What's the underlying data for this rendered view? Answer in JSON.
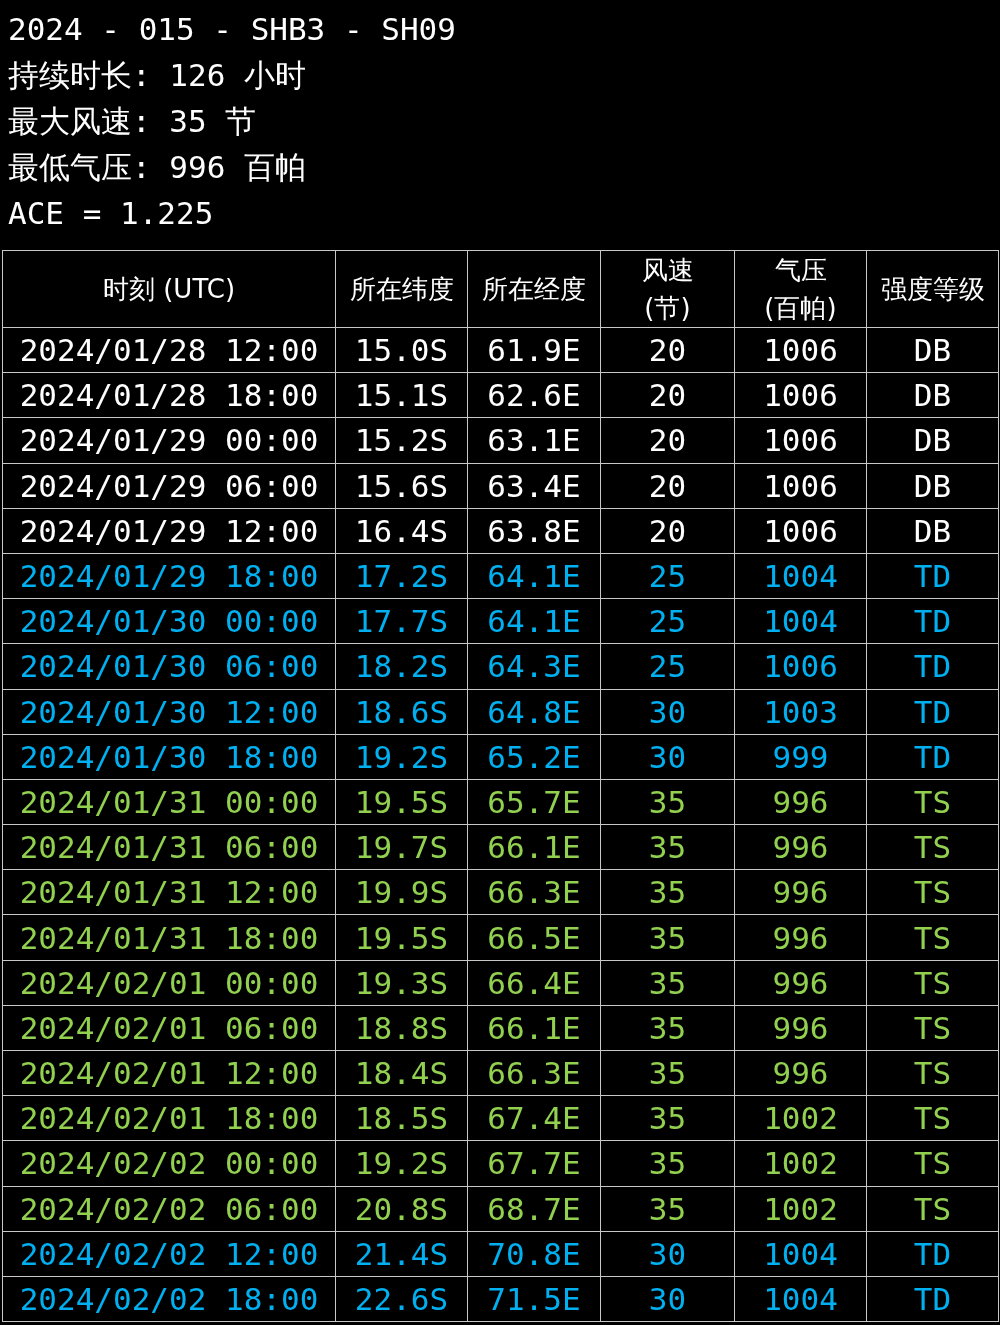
{
  "summary": {
    "title": "2024 - 015 - SHB3 - SH09",
    "lines": [
      "持续时长: 126 小时",
      "最大风速: 35 节",
      "最低气压: 996 百帕",
      "ACE = 1.225"
    ]
  },
  "table": {
    "columns": [
      "时刻 (UTC)",
      "所在纬度",
      "所在经度",
      "风速\n(节)",
      "气压\n(百帕)",
      "强度等级"
    ],
    "rows": [
      {
        "color": "#ffffff",
        "cells": [
          "2024/01/28 12:00",
          "15.0S",
          "61.9E",
          "20",
          "1006",
          "DB"
        ]
      },
      {
        "color": "#ffffff",
        "cells": [
          "2024/01/28 18:00",
          "15.1S",
          "62.6E",
          "20",
          "1006",
          "DB"
        ]
      },
      {
        "color": "#ffffff",
        "cells": [
          "2024/01/29 00:00",
          "15.2S",
          "63.1E",
          "20",
          "1006",
          "DB"
        ]
      },
      {
        "color": "#ffffff",
        "cells": [
          "2024/01/29 06:00",
          "15.6S",
          "63.4E",
          "20",
          "1006",
          "DB"
        ]
      },
      {
        "color": "#ffffff",
        "cells": [
          "2024/01/29 12:00",
          "16.4S",
          "63.8E",
          "20",
          "1006",
          "DB"
        ]
      },
      {
        "color": "#00b0f0",
        "cells": [
          "2024/01/29 18:00",
          "17.2S",
          "64.1E",
          "25",
          "1004",
          "TD"
        ]
      },
      {
        "color": "#00b0f0",
        "cells": [
          "2024/01/30 00:00",
          "17.7S",
          "64.1E",
          "25",
          "1004",
          "TD"
        ]
      },
      {
        "color": "#00b0f0",
        "cells": [
          "2024/01/30 06:00",
          "18.2S",
          "64.3E",
          "25",
          "1006",
          "TD"
        ]
      },
      {
        "color": "#00b0f0",
        "cells": [
          "2024/01/30 12:00",
          "18.6S",
          "64.8E",
          "30",
          "1003",
          "TD"
        ]
      },
      {
        "color": "#00b0f0",
        "cells": [
          "2024/01/30 18:00",
          "19.2S",
          "65.2E",
          "30",
          "999",
          "TD"
        ]
      },
      {
        "color": "#92d050",
        "cells": [
          "2024/01/31 00:00",
          "19.5S",
          "65.7E",
          "35",
          "996",
          "TS"
        ]
      },
      {
        "color": "#92d050",
        "cells": [
          "2024/01/31 06:00",
          "19.7S",
          "66.1E",
          "35",
          "996",
          "TS"
        ]
      },
      {
        "color": "#92d050",
        "cells": [
          "2024/01/31 12:00",
          "19.9S",
          "66.3E",
          "35",
          "996",
          "TS"
        ]
      },
      {
        "color": "#92d050",
        "cells": [
          "2024/01/31 18:00",
          "19.5S",
          "66.5E",
          "35",
          "996",
          "TS"
        ]
      },
      {
        "color": "#92d050",
        "cells": [
          "2024/02/01 00:00",
          "19.3S",
          "66.4E",
          "35",
          "996",
          "TS"
        ]
      },
      {
        "color": "#92d050",
        "cells": [
          "2024/02/01 06:00",
          "18.8S",
          "66.1E",
          "35",
          "996",
          "TS"
        ]
      },
      {
        "color": "#92d050",
        "cells": [
          "2024/02/01 12:00",
          "18.4S",
          "66.3E",
          "35",
          "996",
          "TS"
        ]
      },
      {
        "color": "#92d050",
        "cells": [
          "2024/02/01 18:00",
          "18.5S",
          "67.4E",
          "35",
          "1002",
          "TS"
        ]
      },
      {
        "color": "#92d050",
        "cells": [
          "2024/02/02 00:00",
          "19.2S",
          "67.7E",
          "35",
          "1002",
          "TS"
        ]
      },
      {
        "color": "#92d050",
        "cells": [
          "2024/02/02 06:00",
          "20.8S",
          "68.7E",
          "35",
          "1002",
          "TS"
        ]
      },
      {
        "color": "#00b0f0",
        "cells": [
          "2024/02/02 12:00",
          "21.4S",
          "70.8E",
          "30",
          "1004",
          "TD"
        ]
      },
      {
        "color": "#00b0f0",
        "cells": [
          "2024/02/02 18:00",
          "22.6S",
          "71.5E",
          "30",
          "1004",
          "TD"
        ]
      }
    ]
  }
}
